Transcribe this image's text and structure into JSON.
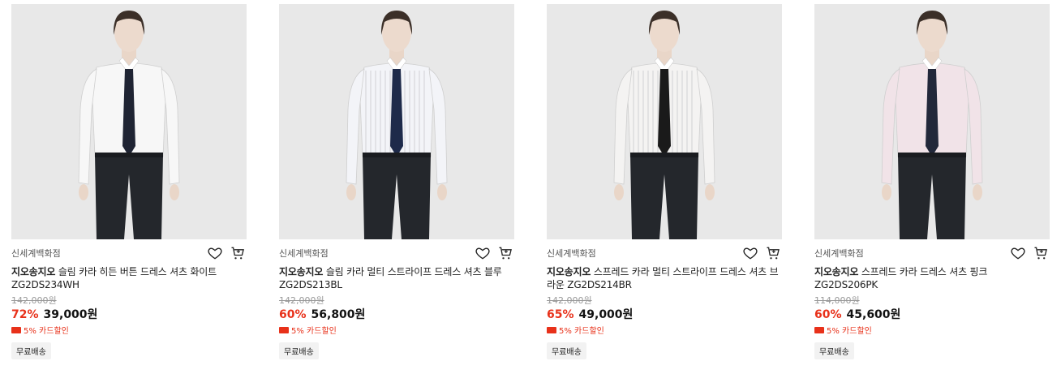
{
  "products": [
    {
      "store": "신세계백화점",
      "brand": "지오송지오",
      "name": "슬림 카라 히든 버튼 드레스 셔츠 화이트 ZG2DS234WH",
      "original_price": "142,000원",
      "discount": "72%",
      "price": "39,000원",
      "card_discount": "5% 카드할인",
      "badge": "무료배송",
      "shirt_color": "#f7f7f7",
      "tie_color": "#1f2433",
      "stripes": false
    },
    {
      "store": "신세계백화점",
      "brand": "지오송지오",
      "name": "슬림 카라 멀티 스트라이프 드레스 셔츠 블루 ZG2DS213BL",
      "original_price": "142,000원",
      "discount": "60%",
      "price": "56,800원",
      "card_discount": "5% 카드할인",
      "badge": "무료배송",
      "shirt_color": "#f3f4f8",
      "tie_color": "#1e2a4a",
      "stripes": true
    },
    {
      "store": "신세계백화점",
      "brand": "지오송지오",
      "name": "스프레드 카라 멀티 스트라이프 드레스 셔츠 브라운 ZG2DS214BR",
      "original_price": "142,000원",
      "discount": "65%",
      "price": "49,000원",
      "card_discount": "5% 카드할인",
      "badge": "무료배송",
      "shirt_color": "#f4f3f2",
      "tie_color": "#1a1a1a",
      "stripes": true
    },
    {
      "store": "신세계백화점",
      "brand": "지오송지오",
      "name": "스프레드 카라 드레스 셔츠 핑크 ZG2DS206PK",
      "original_price": "114,000원",
      "discount": "60%",
      "price": "45,600원",
      "card_discount": "5% 카드할인",
      "badge": "무료배송",
      "shirt_color": "#f1e3e8",
      "tie_color": "#22283a",
      "stripes": false
    }
  ],
  "icons": {
    "wishlist": "heart-icon",
    "cart": "cart-icon",
    "card": "credit-card-icon"
  }
}
